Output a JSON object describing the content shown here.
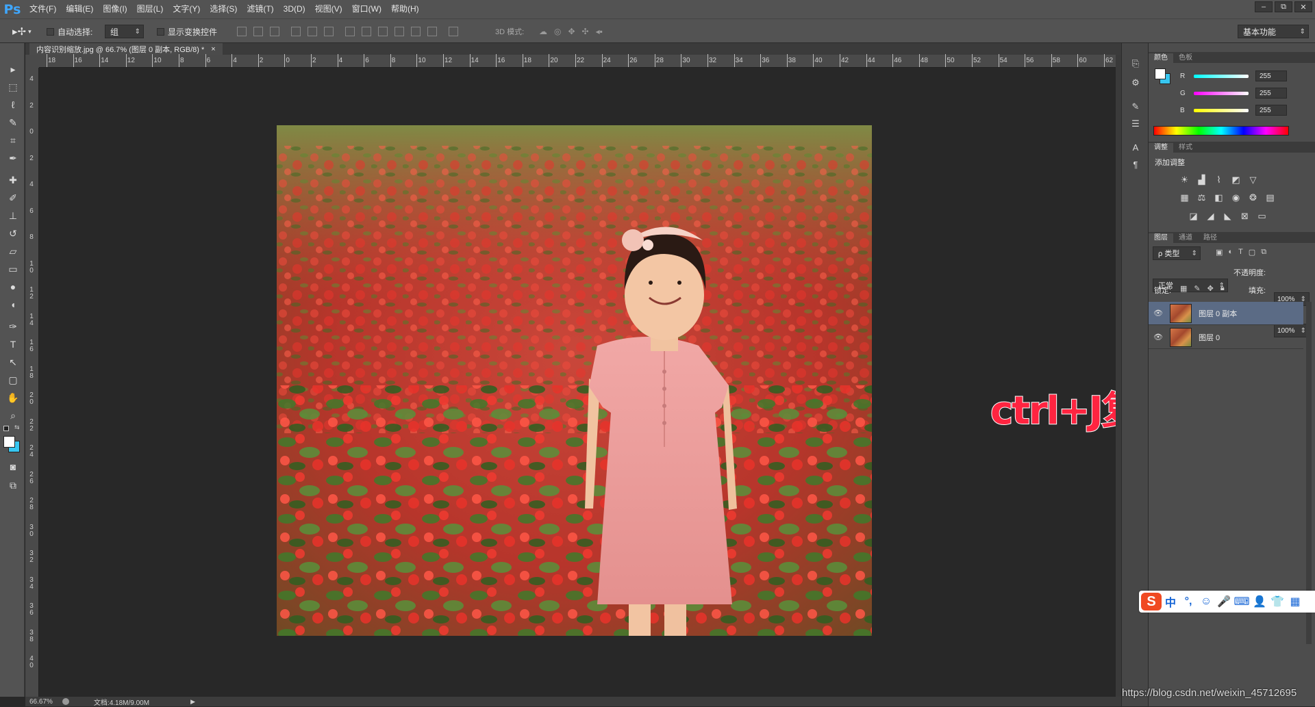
{
  "app": {
    "logo": "Ps"
  },
  "menu": [
    "文件(F)",
    "编辑(E)",
    "图像(I)",
    "图层(L)",
    "文字(Y)",
    "选择(S)",
    "滤镜(T)",
    "3D(D)",
    "视图(V)",
    "窗口(W)",
    "帮助(H)"
  ],
  "window_controls": [
    "–",
    "⧉",
    "✕"
  ],
  "options": {
    "auto_select_label": "自动选择:",
    "auto_select_value": "组",
    "transform_label": "显示变换控件",
    "mode_3d_label": "3D 模式:",
    "workspace": "基本功能"
  },
  "document": {
    "tab_title": "内容识别缩放.jpg @ 66.7% (图层 0 副本, RGB/8) *",
    "tab_close": "×",
    "zoom": "66.67%",
    "doc_info": "文档:4.18M/9.00M"
  },
  "ruler_top_labels": [
    "18",
    "16",
    "14",
    "12",
    "10",
    "8",
    "6",
    "4",
    "2",
    "0",
    "2",
    "4",
    "6",
    "8",
    "10",
    "12",
    "14",
    "16",
    "18",
    "20",
    "22",
    "24",
    "26",
    "28",
    "30",
    "32",
    "34",
    "36",
    "38",
    "40",
    "42",
    "44",
    "46",
    "48",
    "50",
    "52",
    "54",
    "56",
    "58",
    "60",
    "62"
  ],
  "ruler_left_labels": [
    "4",
    "2",
    "0",
    "2",
    "4",
    "6",
    "8",
    "10",
    "12",
    "14",
    "16",
    "18",
    "20",
    "22",
    "24",
    "26",
    "28",
    "30",
    "32",
    "34",
    "36",
    "38",
    "40"
  ],
  "annotation": "ctrl+J复制图层",
  "color_panel": {
    "tabs": [
      "颜色",
      "色板"
    ],
    "channels": [
      {
        "label": "R",
        "value": "255",
        "gradient": "linear-gradient(90deg,#00ffff,#ffffff)"
      },
      {
        "label": "G",
        "value": "255",
        "gradient": "linear-gradient(90deg,#ff00ff,#ffffff)"
      },
      {
        "label": "B",
        "value": "255",
        "gradient": "linear-gradient(90deg,#ffff00,#ffffff)"
      }
    ]
  },
  "adjustments_panel": {
    "tabs": [
      "调整",
      "样式"
    ],
    "title": "添加调整"
  },
  "layers_panel": {
    "tabs": [
      "图层",
      "通道",
      "路径"
    ],
    "filter_label": "ρ 类型",
    "blend_mode": "正常",
    "opacity_label": "不透明度:",
    "opacity_value": "100%",
    "lock_label": "锁定:",
    "fill_label": "填充:",
    "fill_value": "100%",
    "layers": [
      {
        "name": "图层 0 副本",
        "selected": true
      },
      {
        "name": "图层 0",
        "selected": false
      }
    ]
  },
  "ime": {
    "logo": "S",
    "items": [
      "中",
      "°,",
      "☺",
      "🎤",
      "⌨",
      "👤",
      "👕",
      "▦"
    ]
  },
  "watermark": "https://blog.csdn.net/weixin_45712695"
}
